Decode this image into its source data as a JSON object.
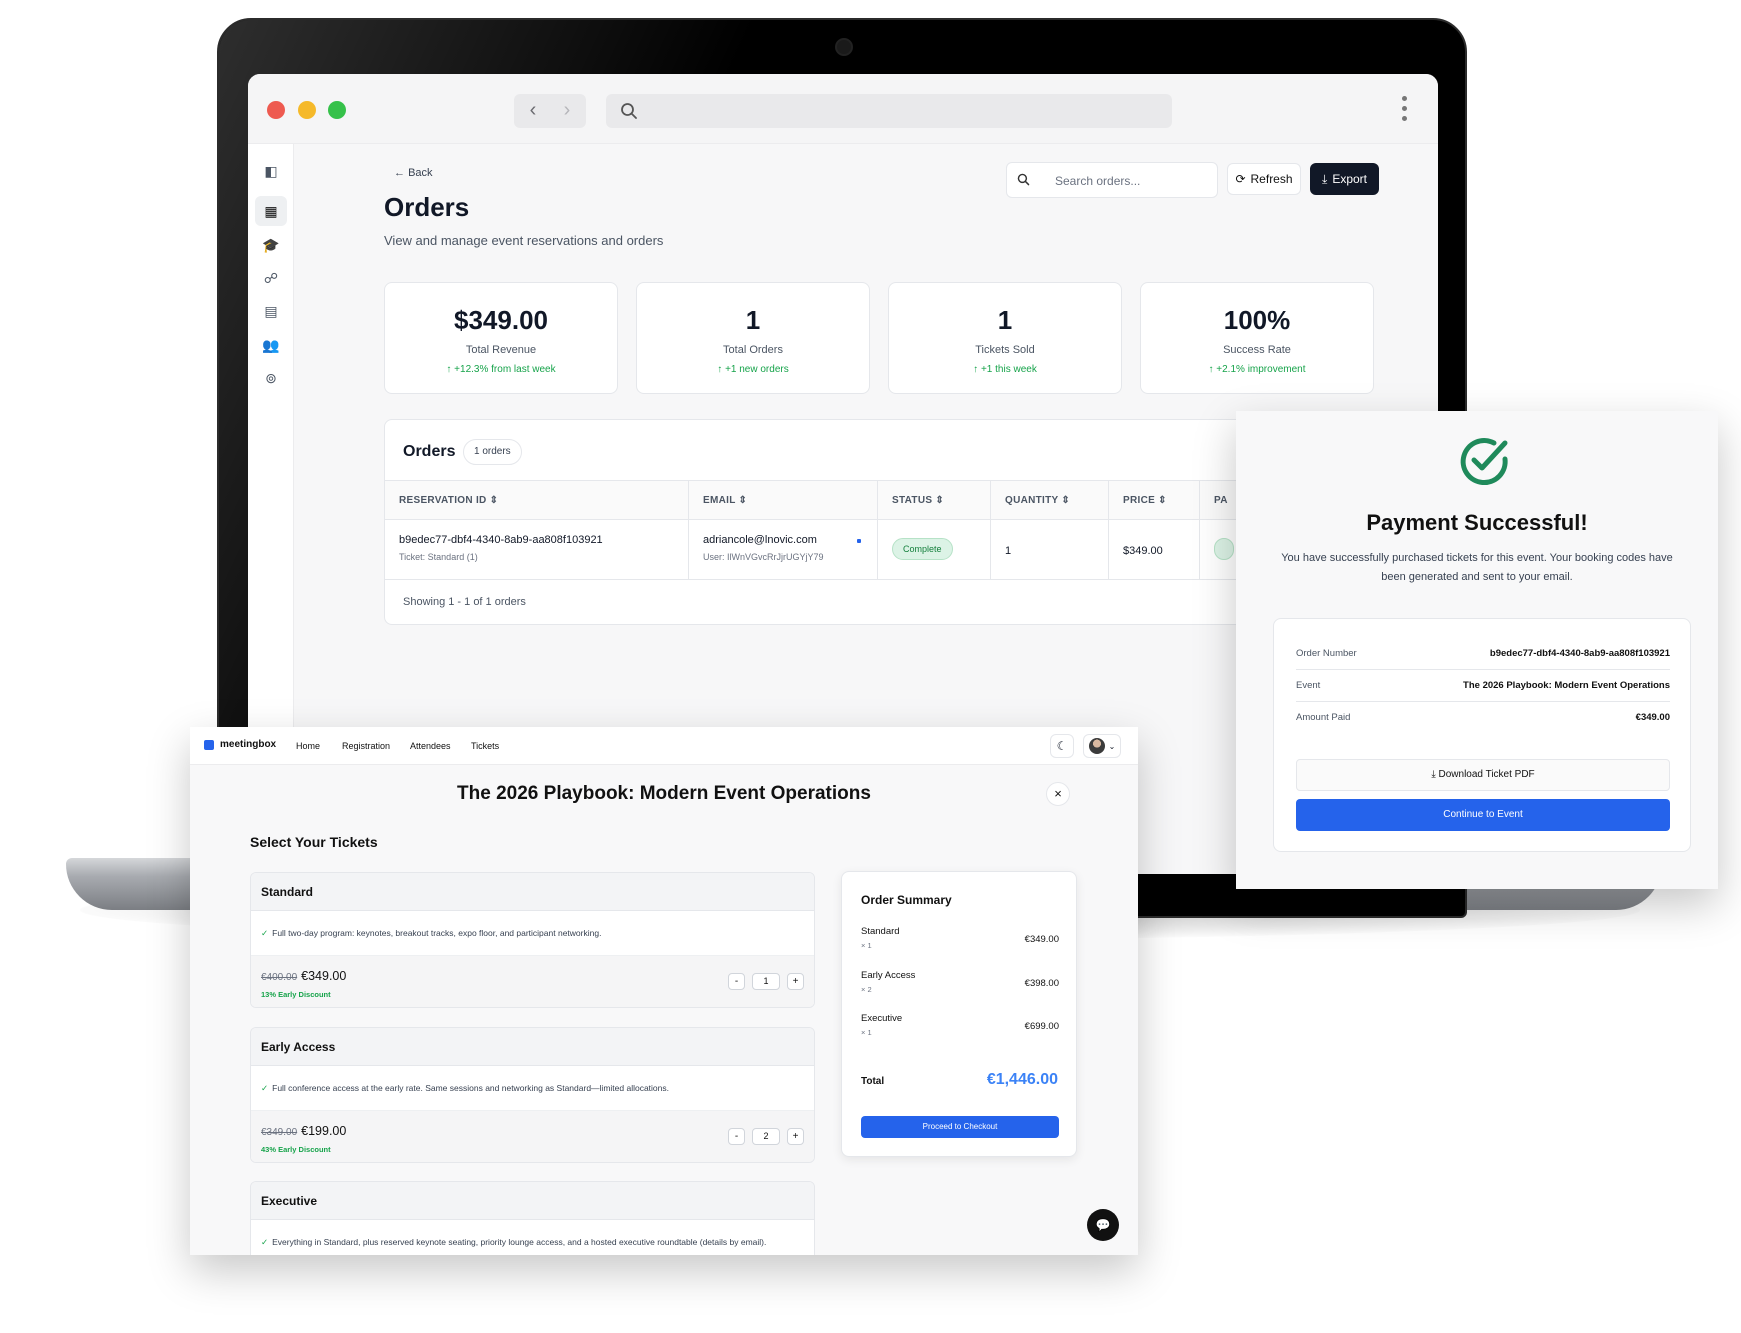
{
  "admin": {
    "back_label": "Back",
    "title": "Orders",
    "subtitle": "View and manage event reservations and orders",
    "search_placeholder": "Search orders...",
    "refresh_label": "Refresh",
    "export_label": "Export",
    "stats": [
      {
        "value": "$349.00",
        "label": "Total Revenue",
        "delta": "+12.3% from last week"
      },
      {
        "value": "1",
        "label": "Total Orders",
        "delta": "+1 new orders"
      },
      {
        "value": "1",
        "label": "Tickets Sold",
        "delta": "+1 this week"
      },
      {
        "value": "100%",
        "label": "Success Rate",
        "delta": "+2.1% improvement"
      }
    ],
    "orders_table": {
      "title": "Orders",
      "count_badge": "1 orders",
      "headers": [
        "RESERVATION ID",
        "EMAIL",
        "STATUS",
        "QUANTITY",
        "PRICE",
        "PA"
      ],
      "rows": [
        {
          "reservation_id": "b9edec77-dbf4-4340-8ab9-aa808f103921",
          "ticket": "Ticket: Standard",
          "ticket_count": "(1)",
          "email": "adriancole@lnovic.com",
          "user": "User: IlWnVGvcRrJjrUGYjY79",
          "status": "Complete",
          "quantity": "1",
          "price": "$349.00"
        }
      ],
      "footer": "Showing 1 - 1 of 1 orders"
    }
  },
  "booking": {
    "brand": "meetingbox",
    "nav": [
      "Home",
      "Registration",
      "Attendees",
      "Tickets"
    ],
    "event_title": "The 2026 Playbook: Modern Event Operations",
    "close_glyph": "×",
    "section_title": "Select Your Tickets",
    "tickets": [
      {
        "name": "Standard",
        "desc": "Full two-day program: keynotes, breakout tracks, expo floor, and participant networking.",
        "old_price": "€400.00",
        "price": "€349.00",
        "discount": "13% Early Discount",
        "qty": "1"
      },
      {
        "name": "Early Access",
        "desc": "Full conference access at the early rate. Same sessions and networking as Standard—limited allocations.",
        "old_price": "€349.00",
        "price": "€199.00",
        "discount": "43% Early Discount",
        "qty": "2"
      },
      {
        "name": "Executive",
        "desc": "Everything in Standard, plus reserved keynote seating, priority lounge access, and a hosted executive roundtable (details by email)."
      }
    ],
    "stepper_minus": "-",
    "stepper_plus": "+",
    "summary": {
      "title": "Order Summary",
      "lines": [
        {
          "name": "Standard",
          "qty": "× 1",
          "price": "€349.00"
        },
        {
          "name": "Early Access",
          "qty": "× 2",
          "price": "€398.00"
        },
        {
          "name": "Executive",
          "qty": "× 1",
          "price": "€699.00"
        }
      ],
      "total_label": "Total",
      "total_value": "€1,446.00",
      "checkout_label": "Proceed to Checkout"
    }
  },
  "payment": {
    "title": "Payment Successful!",
    "message": "You have successfully purchased tickets for this event. Your booking codes have been generated and sent to your email.",
    "rows": [
      {
        "key": "Order Number",
        "value": "b9edec77-dbf4-4340-8ab9-aa808f103921"
      },
      {
        "key": "Event",
        "value": "The 2026 Playbook: Modern Event Operations"
      },
      {
        "key": "Amount Paid",
        "value": "€349.00"
      }
    ],
    "download_label": "Download Ticket PDF",
    "continue_label": "Continue to Event"
  },
  "colors": {
    "accent_blue": "#2563eb",
    "success_green": "#16a34a",
    "check_green": "#1f8a5b",
    "dark_button": "#111827"
  }
}
